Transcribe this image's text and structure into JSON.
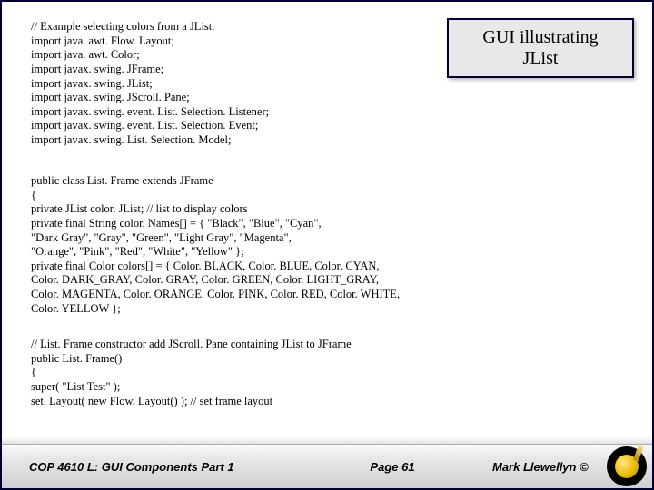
{
  "title_box": {
    "line1": "GUI illustrating",
    "line2": "JList"
  },
  "code_block1": [
    "// Example selecting colors from a JList.",
    "import java. awt. Flow. Layout;",
    "import java. awt. Color;",
    "import javax. swing. JFrame;",
    "import javax. swing. JList;",
    "import javax. swing. JScroll. Pane;",
    "import javax. swing. event. List. Selection. Listener;",
    "import javax. swing. event. List. Selection. Event;",
    "import javax. swing. List. Selection. Model;"
  ],
  "code_block2": [
    "public class List. Frame extends JFrame",
    "{",
    "  private JList color. JList; // list to display colors",
    "  private final String color. Names[] = { \"Black\", \"Blue\", \"Cyan\",",
    "    \"Dark Gray\", \"Gray\", \"Green\", \"Light Gray\", \"Magenta\",",
    "    \"Orange\", \"Pink\", \"Red\", \"White\", \"Yellow\" };",
    "  private final Color colors[] = { Color. BLACK, Color. BLUE, Color. CYAN,",
    "    Color. DARK_GRAY, Color. GRAY, Color. GREEN, Color. LIGHT_GRAY,",
    "    Color. MAGENTA, Color. ORANGE, Color. PINK, Color. RED, Color. WHITE,",
    "    Color. YELLOW };"
  ],
  "code_block3": [
    "  // List. Frame constructor add JScroll. Pane containing JList to JFrame",
    "  public List. Frame()",
    "  {",
    "    super( \"List Test\" );",
    "    set. Layout( new Flow. Layout() ); // set frame layout"
  ],
  "footer": {
    "left": "COP 4610 L: GUI Components Part 1",
    "mid": "Page 61",
    "right": "Mark Llewellyn ©"
  }
}
